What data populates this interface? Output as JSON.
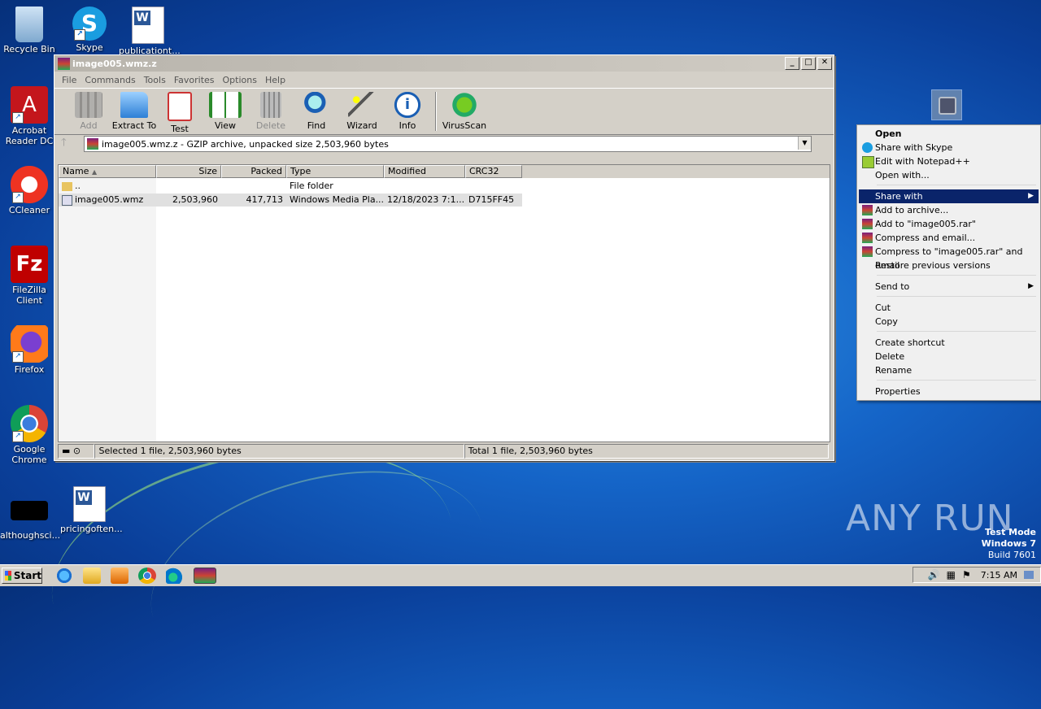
{
  "desktop": {
    "icons": [
      {
        "label": "Recycle Bin"
      },
      {
        "label": "Skype"
      },
      {
        "label": "publicationt..."
      },
      {
        "label": "Acrobat Reader DC"
      },
      {
        "label": "CCleaner"
      },
      {
        "label": "FileZilla Client"
      },
      {
        "label": "Firefox"
      },
      {
        "label": "Google Chrome"
      },
      {
        "label": "althoughsci..."
      },
      {
        "label": "pricingoften..."
      }
    ]
  },
  "window": {
    "title": "image005.wmz.z",
    "menu": [
      "File",
      "Commands",
      "Tools",
      "Favorites",
      "Options",
      "Help"
    ],
    "toolbar": [
      {
        "label": "Add",
        "enabled": false
      },
      {
        "label": "Extract To",
        "enabled": true
      },
      {
        "label": "Test",
        "enabled": true
      },
      {
        "label": "View",
        "enabled": true
      },
      {
        "label": "Delete",
        "enabled": false
      },
      {
        "label": "Find",
        "enabled": true
      },
      {
        "label": "Wizard",
        "enabled": true
      },
      {
        "label": "Info",
        "enabled": true
      },
      {
        "label": "VirusScan",
        "enabled": true
      }
    ],
    "address": "image005.wmz.z - GZIP archive, unpacked size 2,503,960 bytes",
    "columns": [
      "Name",
      "Size",
      "Packed",
      "Type",
      "Modified",
      "CRC32"
    ],
    "rows": [
      {
        "name": "..",
        "size": "",
        "packed": "",
        "type": "File folder",
        "modified": "",
        "crc": ""
      },
      {
        "name": "image005.wmz",
        "size": "2,503,960",
        "packed": "417,713",
        "type": "Windows Media Pla...",
        "modified": "12/18/2023 7:1...",
        "crc": "D715FF45"
      }
    ],
    "status_left": "Selected 1 file, 2,503,960 bytes",
    "status_right": "Total 1 file, 2,503,960 bytes"
  },
  "context_menu": {
    "items": [
      {
        "label": "Open"
      },
      {
        "label": "Share with Skype"
      },
      {
        "label": "Edit with Notepad++"
      },
      {
        "label": "Open with..."
      },
      {
        "label": "Share with"
      },
      {
        "label": "Add to archive..."
      },
      {
        "label": "Add to \"image005.rar\""
      },
      {
        "label": "Compress and email..."
      },
      {
        "label": "Compress to \"image005.rar\" and email"
      },
      {
        "label": "Restore previous versions"
      },
      {
        "label": "Send to"
      },
      {
        "label": "Cut"
      },
      {
        "label": "Copy"
      },
      {
        "label": "Create shortcut"
      },
      {
        "label": "Delete"
      },
      {
        "label": "Rename"
      },
      {
        "label": "Properties"
      }
    ]
  },
  "watermark": {
    "brand": "ANY RUN",
    "line1": "Test Mode",
    "line2": "Windows 7",
    "line3": "Build 7601"
  },
  "taskbar": {
    "start_label": "Start",
    "clock": "7:15 AM"
  }
}
